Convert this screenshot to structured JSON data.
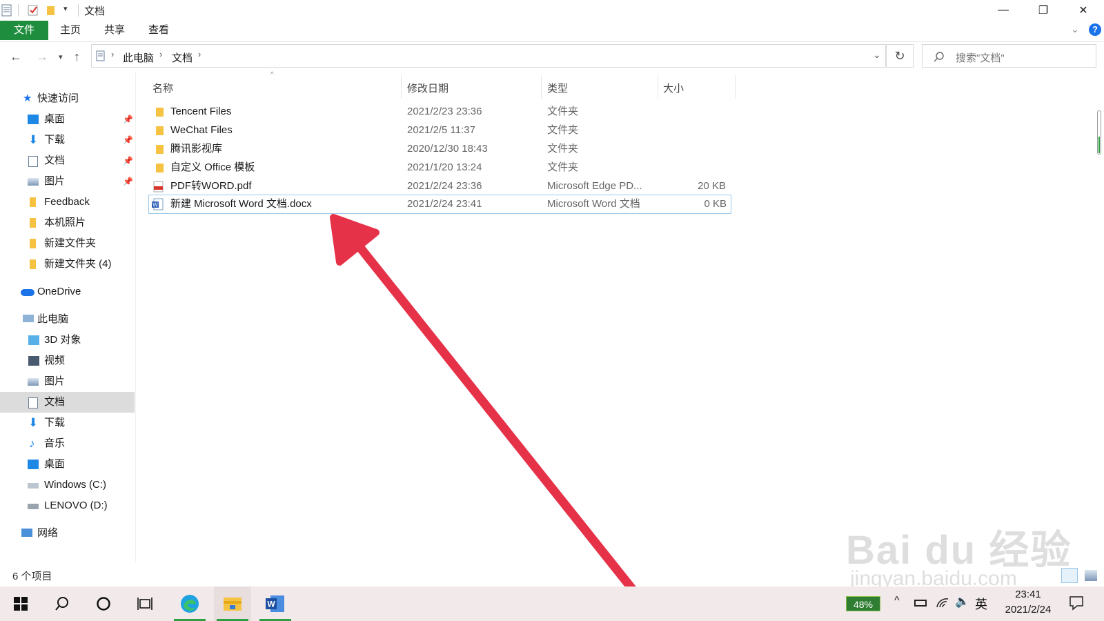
{
  "window": {
    "title": "文档",
    "controls": {
      "minimize": "—",
      "restore": "❐",
      "close": "✕"
    }
  },
  "ribbon": {
    "tabs": [
      "文件",
      "主页",
      "共享",
      "查看"
    ],
    "help": "?"
  },
  "address": {
    "breadcrumb": [
      "此电脑",
      "文档"
    ],
    "search_placeholder": "搜索\"文档\""
  },
  "sidebar": {
    "quick_access": "快速访问",
    "quick_items": [
      "桌面",
      "下载",
      "文档",
      "图片",
      "Feedback",
      "本机照片",
      "新建文件夹",
      "新建文件夹 (4)"
    ],
    "onedrive": "OneDrive",
    "this_pc": "此电脑",
    "pc_items": [
      "3D 对象",
      "视频",
      "图片",
      "文档",
      "下载",
      "音乐",
      "桌面",
      "Windows (C:)",
      "LENOVO (D:)"
    ],
    "network": "网络"
  },
  "columns": {
    "name": "名称",
    "date": "修改日期",
    "type": "类型",
    "size": "大小"
  },
  "files": [
    {
      "name": "Tencent Files",
      "date": "2021/2/23 23:36",
      "type": "文件夹",
      "size": ""
    },
    {
      "name": "WeChat Files",
      "date": "2021/2/5 11:37",
      "type": "文件夹",
      "size": ""
    },
    {
      "name": "腾讯影视库",
      "date": "2020/12/30 18:43",
      "type": "文件夹",
      "size": ""
    },
    {
      "name": "自定义 Office 模板",
      "date": "2021/1/20 13:24",
      "type": "文件夹",
      "size": ""
    },
    {
      "name": "PDF转WORD.pdf",
      "date": "2021/2/24 23:36",
      "type": "Microsoft Edge PD...",
      "size": "20 KB"
    },
    {
      "name": "新建 Microsoft Word 文档.docx",
      "date": "2021/2/24 23:41",
      "type": "Microsoft Word 文档",
      "size": "0 KB"
    }
  ],
  "status": "6 个项目",
  "taskbar": {
    "battery": "48%",
    "ime": "英",
    "time": "23:41",
    "date": "2021/2/24"
  },
  "watermark": {
    "brand": "Bai du 经验",
    "url": "jingyan.baidu.com"
  },
  "colors": {
    "ribbon_file_tab": "#1e8e3e",
    "arrow": "#e53249",
    "selection_border": "#99c7ea"
  }
}
